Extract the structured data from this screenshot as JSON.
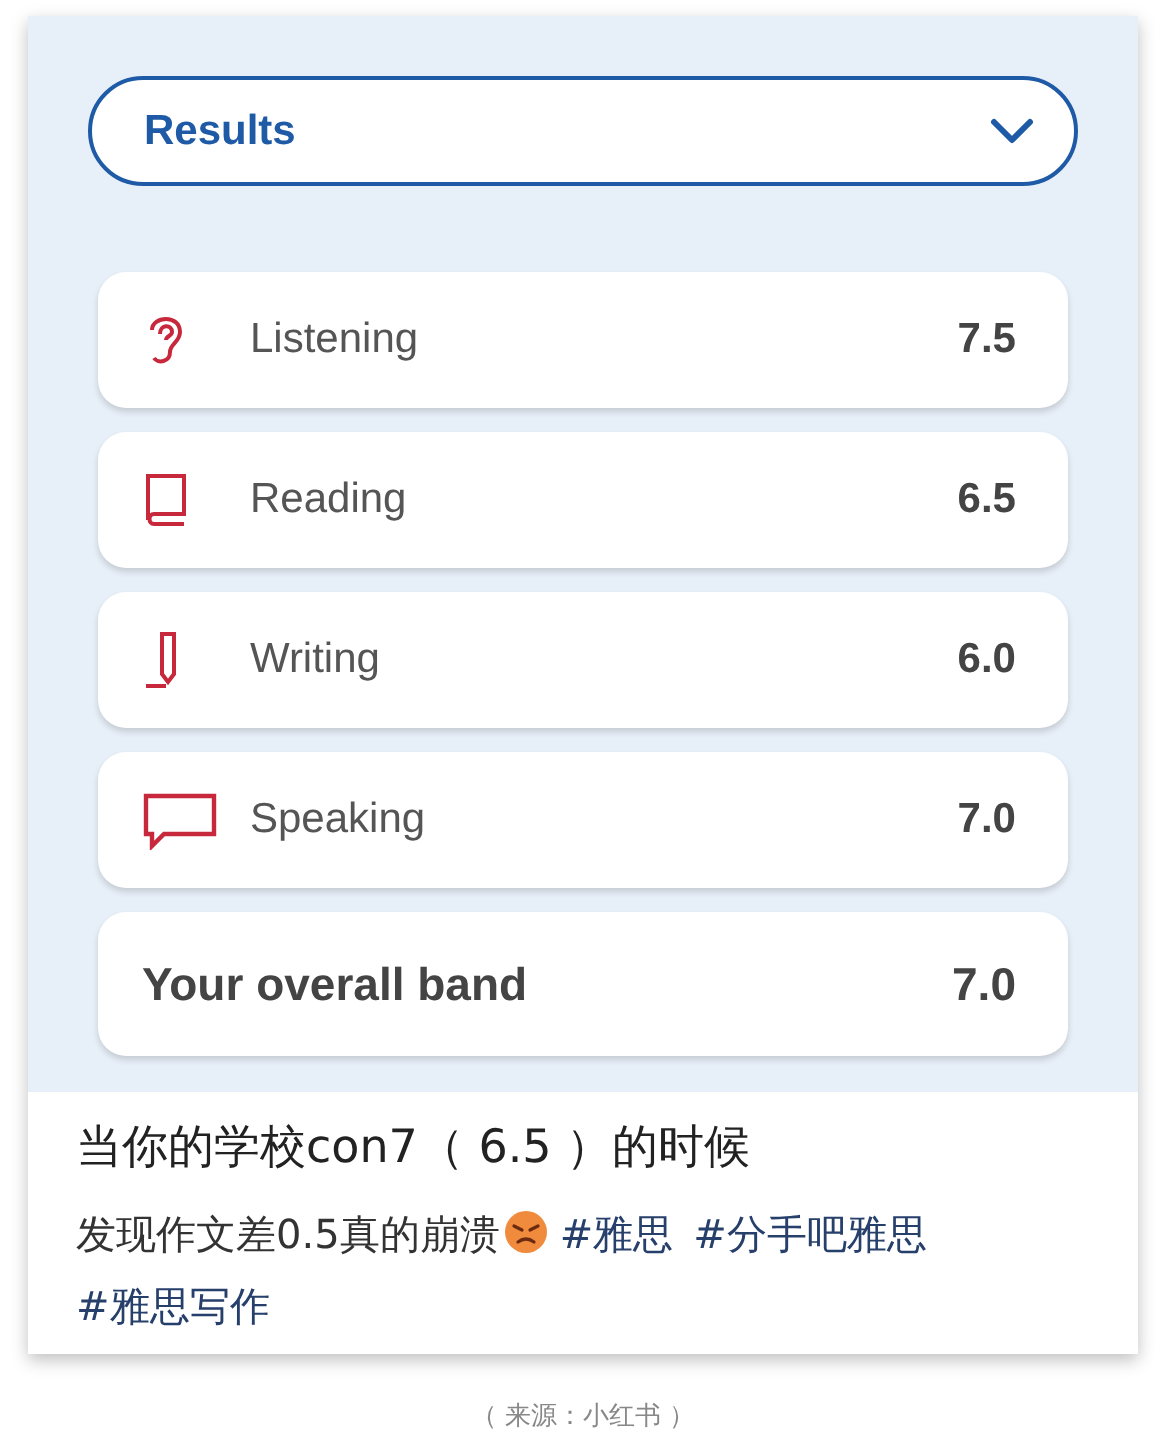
{
  "dropdown": {
    "label": "Results"
  },
  "scores": [
    {
      "kind": "score",
      "label": "Listening",
      "value": "7.5"
    },
    {
      "kind": "score",
      "label": "Reading",
      "value": "6.5"
    },
    {
      "kind": "score",
      "label": "Writing",
      "value": "6.0"
    },
    {
      "kind": "score",
      "label": "Speaking",
      "value": "7.0"
    },
    {
      "kind": "total",
      "label": "Your overall band",
      "value": "7.0"
    }
  ],
  "post": {
    "title": "当你的学校con7（ 6.5 ）的时候",
    "body": "发现作文差0.5真的崩溃",
    "tags": [
      "#雅思",
      "#分手吧雅思",
      "#雅思写作"
    ]
  },
  "caption": "（ 来源：小红书 ）"
}
